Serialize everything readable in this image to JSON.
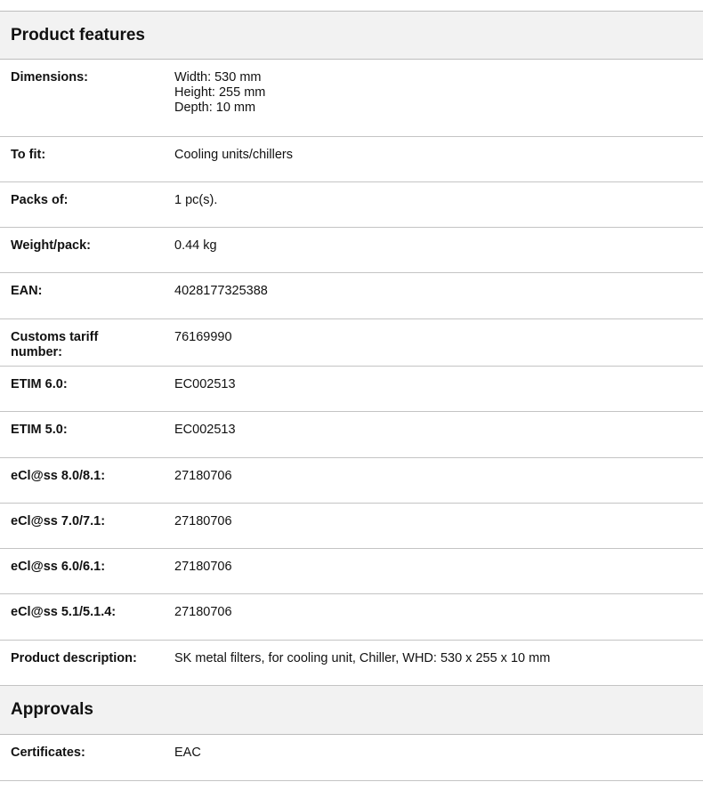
{
  "sections": {
    "features": {
      "title": "Product features",
      "rows": [
        {
          "label": "Dimensions:",
          "lines": [
            "Width: 530 mm",
            "Height: 255 mm",
            "Depth: 10 mm"
          ]
        },
        {
          "label": "To fit:",
          "lines": [
            "Cooling units/chillers"
          ]
        },
        {
          "label": "Packs of:",
          "lines": [
            "1 pc(s)."
          ]
        },
        {
          "label": "Weight/pack:",
          "lines": [
            "0.44 kg"
          ]
        },
        {
          "label": "EAN:",
          "lines": [
            "4028177325388"
          ]
        },
        {
          "label": "Customs tariff number:",
          "lines": [
            "76169990"
          ]
        },
        {
          "label": "ETIM 6.0:",
          "lines": [
            "EC002513"
          ]
        },
        {
          "label": "ETIM 5.0:",
          "lines": [
            "EC002513"
          ]
        },
        {
          "label": "eCl@ss 8.0/8.1:",
          "lines": [
            "27180706"
          ]
        },
        {
          "label": "eCl@ss 7.0/7.1:",
          "lines": [
            "27180706"
          ]
        },
        {
          "label": "eCl@ss 6.0/6.1:",
          "lines": [
            "27180706"
          ]
        },
        {
          "label": "eCl@ss 5.1/5.1.4:",
          "lines": [
            "27180706"
          ]
        },
        {
          "label": "Product description:",
          "lines": [
            "SK metal filters, for cooling unit, Chiller, WHD: 530 x 255 x 10 mm"
          ]
        }
      ]
    },
    "approvals": {
      "title": "Approvals",
      "rows": [
        {
          "label": "Certificates:",
          "lines": [
            "EAC"
          ]
        }
      ]
    }
  }
}
